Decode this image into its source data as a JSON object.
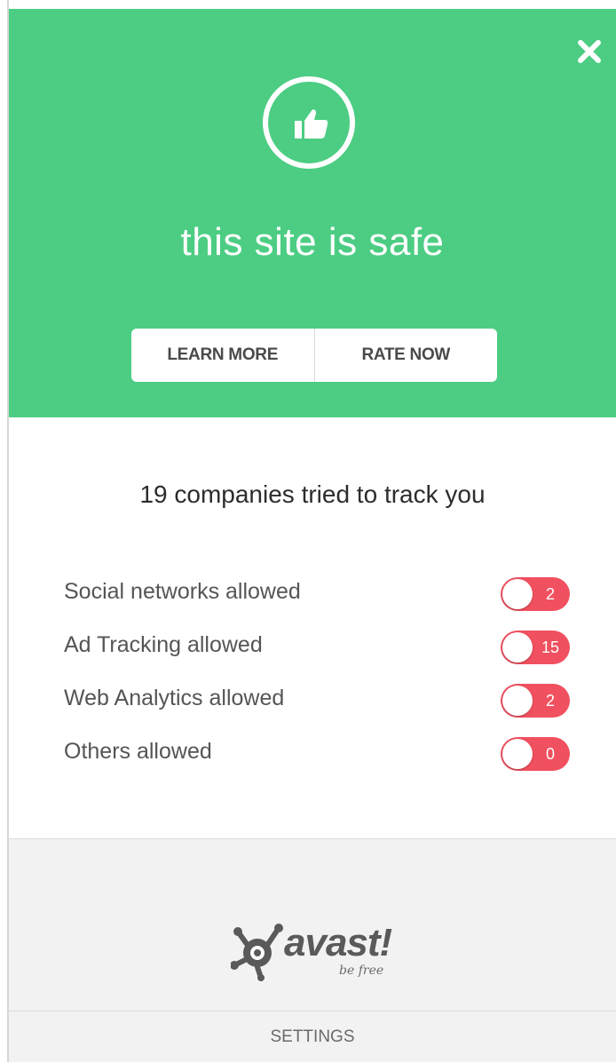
{
  "header": {
    "status_title": "this site is safe",
    "close_icon": "close-icon",
    "status_icon": "thumbs-up-icon",
    "buttons": {
      "learn_more": "LEARN MORE",
      "rate_now": "RATE NOW"
    },
    "background_color": "#4ccd83"
  },
  "tracking": {
    "summary": "19 companies tried to track you",
    "items": [
      {
        "label": "Social networks allowed",
        "count": "2"
      },
      {
        "label": "Ad Tracking allowed",
        "count": "15"
      },
      {
        "label": "Web Analytics allowed",
        "count": "2"
      },
      {
        "label": "Others allowed",
        "count": "0"
      }
    ],
    "toggle_color": "#f0505f"
  },
  "footer": {
    "brand": "avast!",
    "tagline": "be free",
    "settings_label": "SETTINGS"
  }
}
